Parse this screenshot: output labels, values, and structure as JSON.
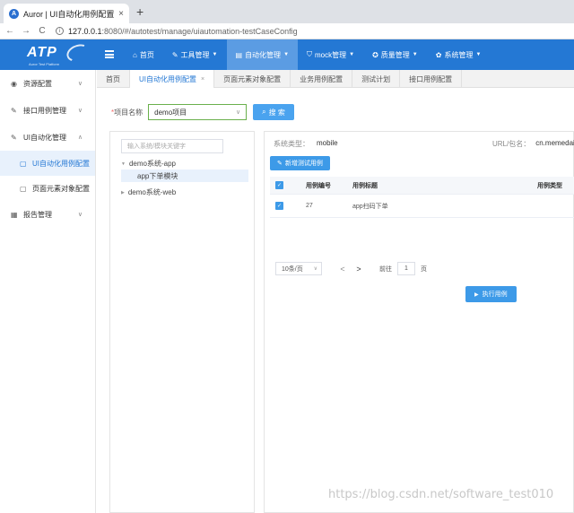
{
  "browser": {
    "tab_title": "Auror | UI自动化用例配置",
    "tab_close": "×",
    "new_tab": "+",
    "nav_back": "←",
    "nav_forward": "→",
    "nav_reload": "C",
    "url_host": "127.0.0.1",
    "url_path": ":8080/#/autotest/manage/uiautomation-testCaseConfig"
  },
  "header": {
    "logo_text": "ATP",
    "logo_sub": "Auror Test Platform",
    "nav": [
      {
        "label": "首页",
        "icon": "⌂"
      },
      {
        "label": "工具管理",
        "icon": "✎"
      },
      {
        "label": "自动化管理",
        "icon": "▤"
      },
      {
        "label": "mock管理",
        "icon": "⛉"
      },
      {
        "label": "质量管理",
        "icon": "✪"
      },
      {
        "label": "系统管理",
        "icon": "✿"
      }
    ]
  },
  "sidebar": {
    "items": [
      {
        "label": "资源配置",
        "icon": "◉",
        "chev": "∨"
      },
      {
        "label": "接口用例管理",
        "icon": "✎",
        "chev": "∨"
      },
      {
        "label": "UI自动化管理",
        "icon": "✎",
        "chev": "∧"
      }
    ],
    "sub": [
      {
        "label": "UI自动化用例配置",
        "icon": "▢"
      },
      {
        "label": "页面元素对象配置",
        "icon": "▢"
      }
    ],
    "report": {
      "label": "报告管理",
      "icon": "▦",
      "chev": "∨"
    }
  },
  "tabs": [
    {
      "label": "首页"
    },
    {
      "label": "UI自动化用例配置",
      "close": "×"
    },
    {
      "label": "页面元素对象配置"
    },
    {
      "label": "业务用例配置"
    },
    {
      "label": "测试计划"
    },
    {
      "label": "接口用例配置"
    }
  ],
  "project": {
    "label": "项目名称",
    "required": "*",
    "value": "demo项目",
    "caret": "∨",
    "search_label": "搜 索",
    "search_icon": "⌕"
  },
  "tree": {
    "filter_placeholder": "输入系统/模块关键字",
    "nodes": [
      {
        "label": "demo系统-app",
        "caret": "▼"
      },
      {
        "label": "app下单模块"
      },
      {
        "label": "demo系统-web",
        "caret": "▶"
      }
    ]
  },
  "detail": {
    "sys_type_label": "系统类型：",
    "sys_type_value": "mobile",
    "url_label": "URL/包名：",
    "url_value": "cn.memedai.m",
    "new_btn": "新增测试用例",
    "new_icon": "✎",
    "table": {
      "headers": [
        "用例编号",
        "用例标题",
        "用例类型"
      ],
      "rows": [
        {
          "id": "27",
          "title": "app扫码下单",
          "type": ""
        }
      ]
    },
    "pager": {
      "page_size": "10条/页",
      "prev": "<",
      "next": ">",
      "goto": "前往",
      "page": "1",
      "page_unit": "页"
    },
    "run_btn": "执行用例",
    "run_icon": "▶"
  },
  "watermark": "https://blog.csdn.net/software_test010"
}
